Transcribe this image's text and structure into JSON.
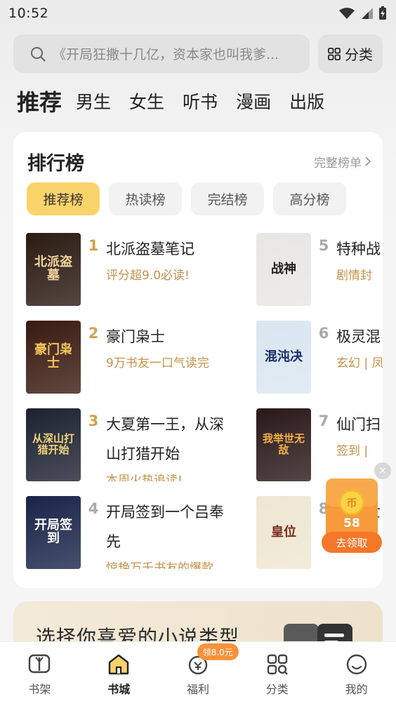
{
  "status": {
    "time": "10:52"
  },
  "search": {
    "placeholder": "《开局狂撒十几亿，资本家也叫我爹..."
  },
  "category_button": {
    "label": "分类",
    "icon": "grid-icon"
  },
  "tabs": [
    {
      "label": "推荐",
      "active": true
    },
    {
      "label": "男生"
    },
    {
      "label": "女生"
    },
    {
      "label": "听书"
    },
    {
      "label": "漫画"
    },
    {
      "label": "出版"
    }
  ],
  "ranking": {
    "title": "排行榜",
    "more": "完整榜单",
    "subtabs": [
      {
        "label": "推荐榜",
        "active": true
      },
      {
        "label": "热读榜"
      },
      {
        "label": "完结榜"
      },
      {
        "label": "高分榜"
      }
    ],
    "items": [
      {
        "rank": "1",
        "title": "北派盗墓笔记",
        "desc": "评分超9.0必读!",
        "cover_text": "北派盗墓",
        "cover_bg": "#2a1a12",
        "cover_fg": "#f2d6a0"
      },
      {
        "rank": "2",
        "title": "豪门枭士",
        "desc": "9万书友一口气读完",
        "cover_text": "豪门枭士",
        "cover_bg": "#3a1a10",
        "cover_fg": "#f5c25a"
      },
      {
        "rank": "3",
        "title": "大夏第一王，从深山打猎开始",
        "desc": "本周火热追读!",
        "cover_text": "从深山打猎开始",
        "cover_bg": "#1c2230",
        "cover_fg": "#f3d47a"
      },
      {
        "rank": "4",
        "title": "开局签到一个吕奉先",
        "desc": "惊艳万千书友的爆款",
        "cover_text": "开局签到",
        "cover_bg": "#1a2448",
        "cover_fg": "#ffffff"
      },
      {
        "rank": "5",
        "title": "特种战",
        "desc": "剧情封",
        "cover_text": "战神",
        "cover_bg": "#e8e6e2",
        "cover_fg": "#222222"
      },
      {
        "rank": "6",
        "title": "极灵混",
        "desc": "玄幻 | 凤",
        "cover_text": "混沌决",
        "cover_bg": "#d9e6f0",
        "cover_fg": "#1a2a6a"
      },
      {
        "rank": "7",
        "title": "仙门扫",
        "desc": "签到 |",
        "cover_text": "我举世无敌",
        "cover_bg": "#2a1818",
        "cover_fg": "#f2b24a"
      },
      {
        "rank": "8",
        "title": "我举世",
        "desc": "",
        "cover_text": "皇位",
        "cover_bg": "#efe6d2",
        "cover_fg": "#7a2a1a"
      }
    ]
  },
  "promo": {
    "title": "选择你喜爱的小说类型"
  },
  "reward": {
    "amount": "58",
    "button": "去领取",
    "close": "×"
  },
  "bottom_nav": [
    {
      "label": "书架",
      "icon": "bookshelf-icon"
    },
    {
      "label": "书城",
      "icon": "home-icon",
      "active": true
    },
    {
      "label": "福利",
      "icon": "gift-icon",
      "badge": "领8.0元"
    },
    {
      "label": "分类",
      "icon": "category-icon"
    },
    {
      "label": "我的",
      "icon": "profile-icon"
    }
  ],
  "colors": {
    "accent": "#fbd36b",
    "rank_top": "#d4a04b",
    "desc": "#c4914a",
    "badge": "#f7923b"
  }
}
